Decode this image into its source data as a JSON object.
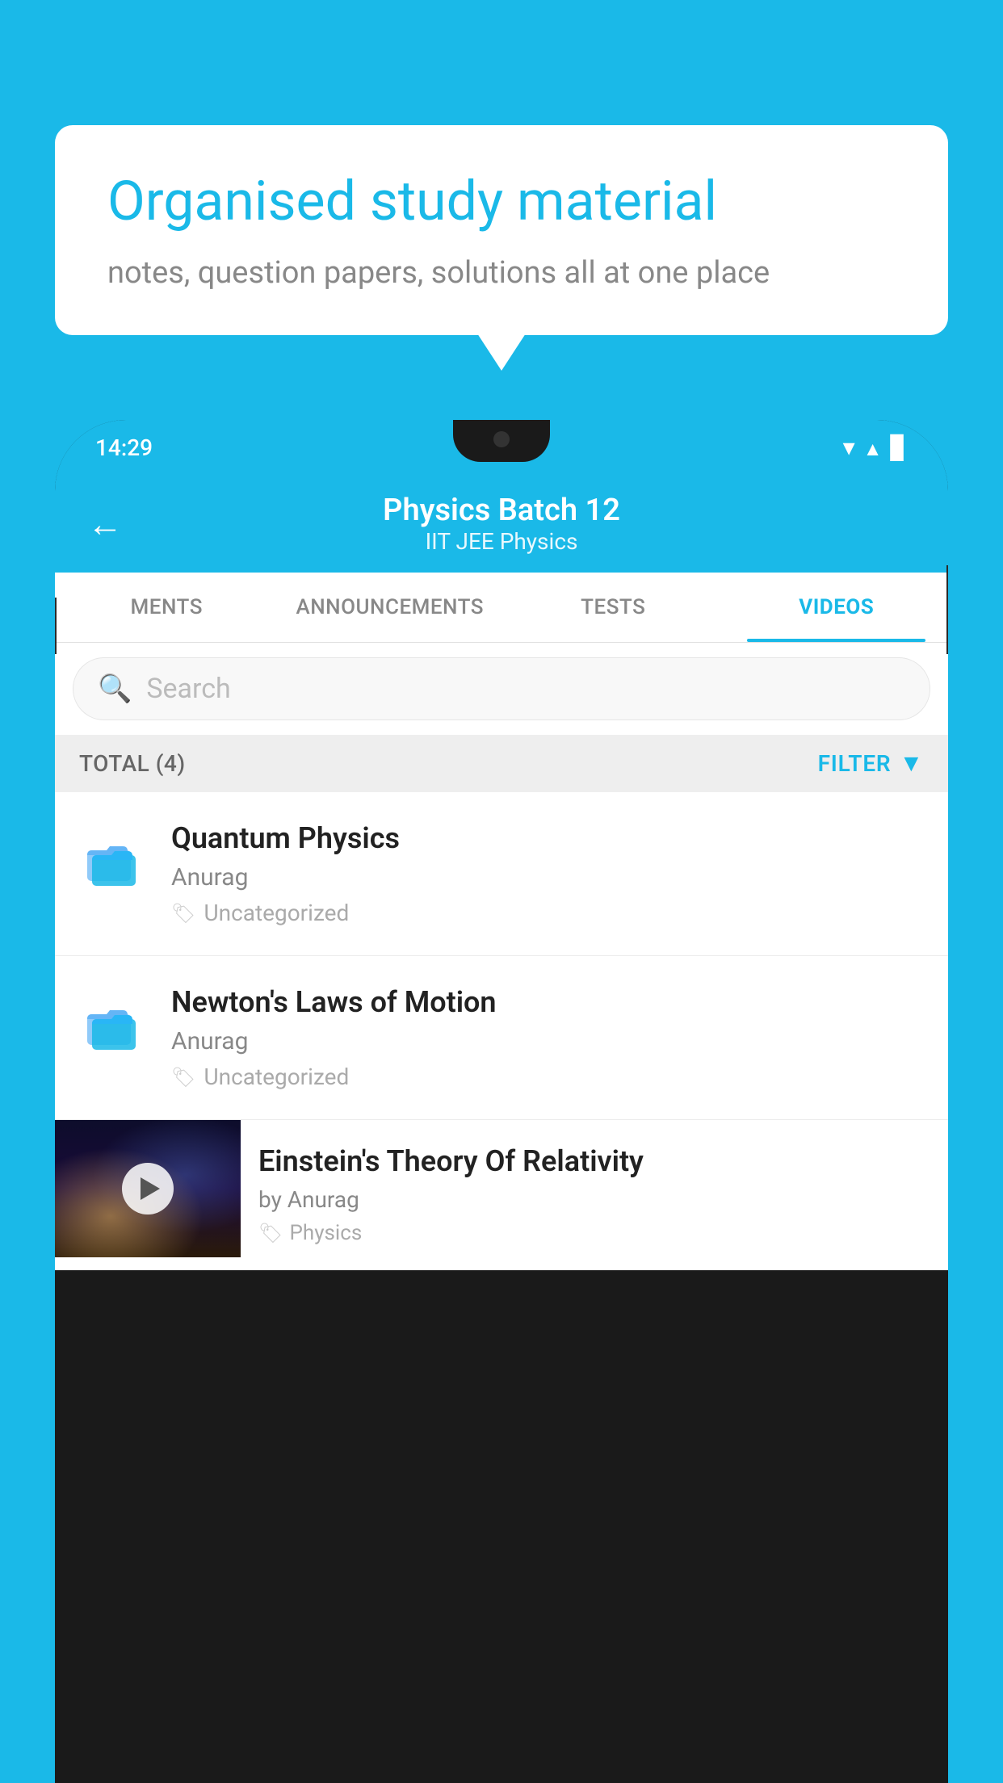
{
  "background_color": "#1ab9e8",
  "speech_bubble": {
    "heading": "Organised study material",
    "subtext": "notes, question papers, solutions all at one place"
  },
  "status_bar": {
    "time": "14:29"
  },
  "app_bar": {
    "back_label": "←",
    "batch_name": "Physics Batch 12",
    "batch_sub": "IIT JEE   Physics"
  },
  "tabs": [
    {
      "label": "MENTS",
      "active": false
    },
    {
      "label": "ANNOUNCEMENTS",
      "active": false
    },
    {
      "label": "TESTS",
      "active": false
    },
    {
      "label": "VIDEOS",
      "active": true
    }
  ],
  "search": {
    "placeholder": "Search"
  },
  "filter_row": {
    "total_label": "TOTAL (4)",
    "filter_label": "FILTER"
  },
  "list_items": [
    {
      "id": "quantum-physics",
      "title": "Quantum Physics",
      "author": "Anurag",
      "tag": "Uncategorized",
      "type": "folder"
    },
    {
      "id": "newtons-laws",
      "title": "Newton's Laws of Motion",
      "author": "Anurag",
      "tag": "Uncategorized",
      "type": "folder"
    }
  ],
  "video_item": {
    "title": "Einstein's Theory Of Relativity",
    "author": "by Anurag",
    "tag": "Physics",
    "type": "video"
  }
}
